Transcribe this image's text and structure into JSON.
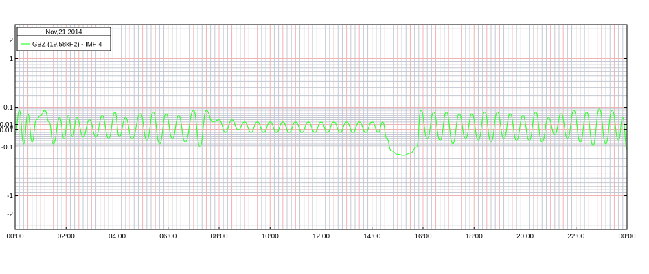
{
  "chart_data": {
    "type": "line",
    "title": "Nov,21 2014",
    "xlabel": "",
    "ylabel": "",
    "y_scale": "symlog",
    "xlim": [
      "00:00",
      "24:00"
    ],
    "ylim": [
      -3.5,
      3.5
    ],
    "x_tick_labels": [
      "00:00",
      "02:00",
      "04:00",
      "06:00",
      "08:00",
      "10:00",
      "12:00",
      "14:00",
      "16:00",
      "18:00",
      "20:00",
      "22:00",
      "00:00"
    ],
    "y_tick_labels": [
      {
        "value": 2,
        "label": "2"
      },
      {
        "value": 1,
        "label": "1"
      },
      {
        "value": 0.1,
        "label": "0.1"
      },
      {
        "value": 0.01,
        "label": "0.01"
      },
      {
        "value": 0,
        "label": "0"
      },
      {
        "value": -0.01,
        "label": "-0.01"
      },
      {
        "value": -0.1,
        "label": "-0.1"
      },
      {
        "value": -1,
        "label": "-1"
      },
      {
        "value": -2,
        "label": "-2"
      }
    ],
    "grid": true,
    "legend_position": "top-left",
    "series": [
      {
        "name": "GBZ (19.58kHz) - IMF 4",
        "color": "#33ff33",
        "points": [
          [
            "00:00",
            -0.03
          ],
          [
            "00:10",
            0.08
          ],
          [
            "00:20",
            -0.08
          ],
          [
            "00:30",
            0.06
          ],
          [
            "00:40",
            -0.07
          ],
          [
            "00:50",
            0.03
          ],
          [
            "01:00",
            0.05
          ],
          [
            "01:10",
            0.08
          ],
          [
            "01:20",
            0.02
          ],
          [
            "01:30",
            -0.08
          ],
          [
            "01:45",
            0.04
          ],
          [
            "01:55",
            -0.05
          ],
          [
            "02:05",
            0.05
          ],
          [
            "02:15",
            -0.04
          ],
          [
            "02:25",
            0.04
          ],
          [
            "02:40",
            -0.04
          ],
          [
            "02:55",
            0.03
          ],
          [
            "03:10",
            -0.04
          ],
          [
            "03:25",
            0.05
          ],
          [
            "03:40",
            -0.05
          ],
          [
            "03:55",
            0.07
          ],
          [
            "04:05",
            -0.04
          ],
          [
            "04:20",
            0.04
          ],
          [
            "04:35",
            -0.05
          ],
          [
            "04:55",
            0.06
          ],
          [
            "05:10",
            -0.06
          ],
          [
            "05:25",
            0.07
          ],
          [
            "05:40",
            -0.08
          ],
          [
            "05:55",
            0.06
          ],
          [
            "06:10",
            -0.05
          ],
          [
            "06:25",
            0.05
          ],
          [
            "06:40",
            -0.07
          ],
          [
            "07:00",
            0.08
          ],
          [
            "07:15",
            -0.1
          ],
          [
            "07:30",
            0.08
          ],
          [
            "07:45",
            0.02
          ],
          [
            "08:00",
            0.03
          ],
          [
            "08:15",
            -0.02
          ],
          [
            "08:30",
            0.03
          ],
          [
            "08:45",
            -0.01
          ],
          [
            "09:00",
            0.02
          ],
          [
            "09:15",
            -0.02
          ],
          [
            "09:30",
            0.02
          ],
          [
            "09:45",
            -0.02
          ],
          [
            "10:00",
            0.02
          ],
          [
            "10:15",
            -0.02
          ],
          [
            "10:30",
            0.02
          ],
          [
            "10:45",
            -0.02
          ],
          [
            "11:00",
            0.02
          ],
          [
            "11:15",
            -0.02
          ],
          [
            "11:30",
            0.02
          ],
          [
            "11:45",
            -0.02
          ],
          [
            "12:00",
            0.02
          ],
          [
            "12:15",
            -0.02
          ],
          [
            "12:30",
            0.02
          ],
          [
            "12:45",
            -0.02
          ],
          [
            "13:00",
            0.02
          ],
          [
            "13:15",
            -0.02
          ],
          [
            "13:30",
            0.02
          ],
          [
            "13:45",
            -0.02
          ],
          [
            "14:00",
            0.02
          ],
          [
            "14:15",
            -0.02
          ],
          [
            "14:25",
            0.02
          ],
          [
            "14:35",
            -0.05
          ],
          [
            "14:45",
            -0.13
          ],
          [
            "15:00",
            -0.16
          ],
          [
            "15:15",
            -0.17
          ],
          [
            "15:30",
            -0.15
          ],
          [
            "15:45",
            -0.1
          ],
          [
            "15:55",
            0.08
          ],
          [
            "16:10",
            -0.05
          ],
          [
            "16:25",
            0.07
          ],
          [
            "16:40",
            -0.06
          ],
          [
            "16:55",
            0.07
          ],
          [
            "17:10",
            -0.08
          ],
          [
            "17:25",
            0.06
          ],
          [
            "17:40",
            -0.05
          ],
          [
            "17:55",
            0.06
          ],
          [
            "18:10",
            -0.06
          ],
          [
            "18:25",
            0.07
          ],
          [
            "18:40",
            -0.07
          ],
          [
            "18:55",
            0.07
          ],
          [
            "19:10",
            -0.05
          ],
          [
            "19:25",
            0.06
          ],
          [
            "19:40",
            -0.06
          ],
          [
            "19:55",
            0.05
          ],
          [
            "20:10",
            -0.06
          ],
          [
            "20:25",
            0.07
          ],
          [
            "20:40",
            -0.07
          ],
          [
            "20:55",
            0.04
          ],
          [
            "21:10",
            -0.03
          ],
          [
            "21:25",
            0.06
          ],
          [
            "21:40",
            -0.05
          ],
          [
            "21:55",
            0.08
          ],
          [
            "22:10",
            -0.07
          ],
          [
            "22:25",
            0.07
          ],
          [
            "22:40",
            -0.09
          ],
          [
            "22:55",
            0.09
          ],
          [
            "23:10",
            -0.08
          ],
          [
            "23:25",
            0.08
          ],
          [
            "23:40",
            -0.06
          ],
          [
            "23:50",
            0.04
          ],
          [
            "24:00",
            -0.12
          ]
        ]
      }
    ]
  }
}
